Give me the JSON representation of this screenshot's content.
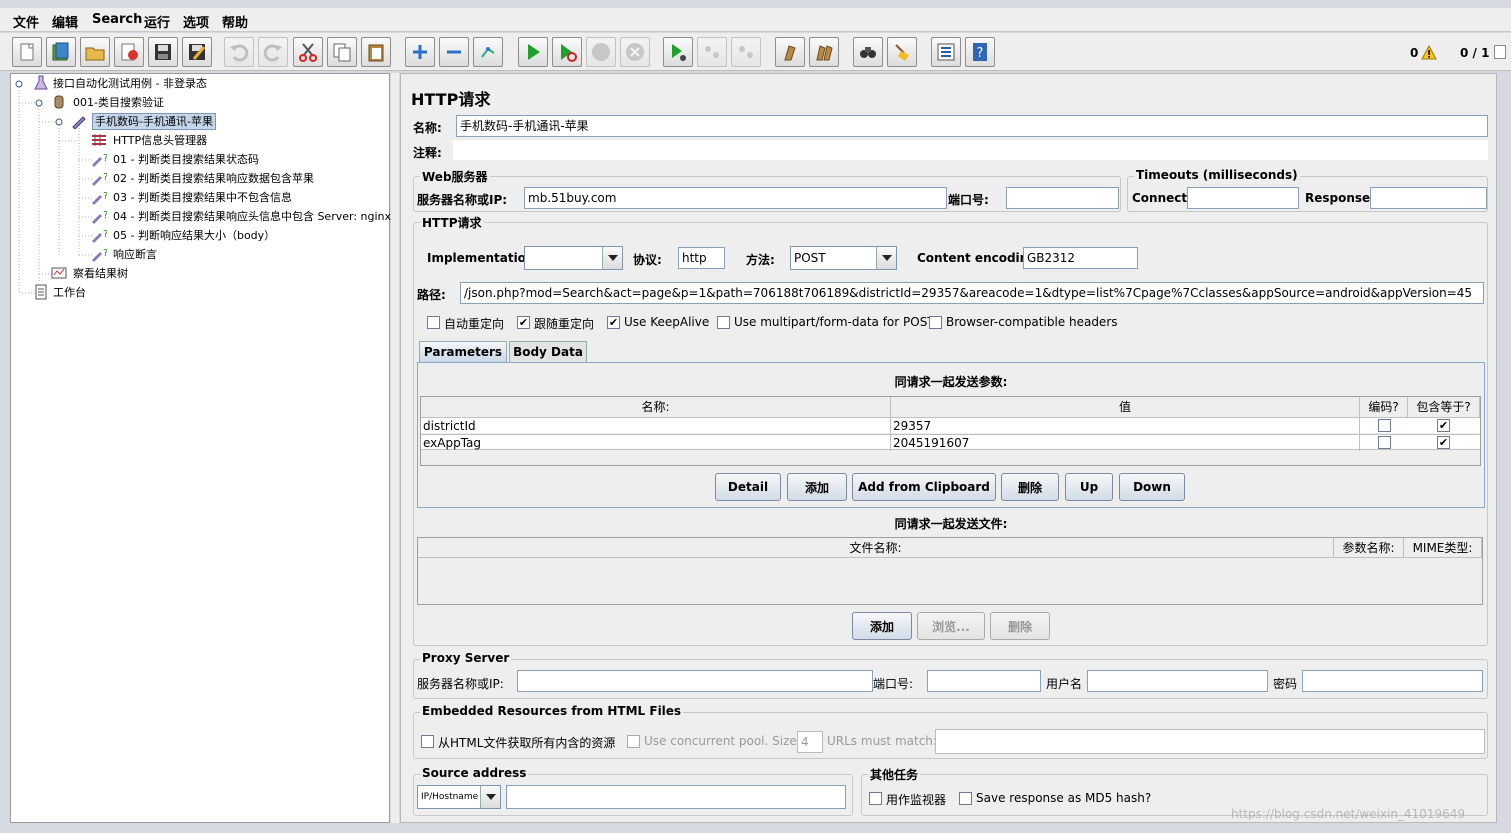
{
  "menubar": {
    "items": [
      "文件",
      "编辑",
      "Search",
      "运行",
      "选项",
      "帮助"
    ]
  },
  "toolbar": {
    "icons": [
      "new-icon",
      "templates-icon",
      "open-icon",
      "close-icon",
      "save-icon",
      "save-as-icon",
      "undo-icon",
      "redo-icon",
      "cut-icon",
      "copy-icon",
      "paste-icon",
      "expand-icon",
      "collapse-icon",
      "toggle-icon",
      "start-icon",
      "start-no-pause-icon",
      "stop-icon",
      "shutdown-icon",
      "remote-start-icon",
      "remote-stop-icon",
      "remote-exit-icon",
      "clear-icon",
      "clear-all-icon",
      "search-icon",
      "reset-search-icon",
      "function-helper-icon",
      "help-icon"
    ],
    "warnings": "0",
    "threads": "0 / 1"
  },
  "tree": {
    "items": [
      {
        "label": "接口自动化测试用例 - 非登录态",
        "icon": "test-plan-icon",
        "selected": false
      },
      {
        "label": "001-类目搜索验证",
        "icon": "thread-group-icon",
        "selected": false
      },
      {
        "label": "手机数码-手机通讯-苹果",
        "icon": "sampler-icon",
        "selected": true
      },
      {
        "label": "HTTP信息头管理器",
        "icon": "header-manager-icon",
        "selected": false
      },
      {
        "label": "01 - 判断类目搜索结果状态码",
        "icon": "assertion-icon",
        "selected": false
      },
      {
        "label": "02 - 判断类目搜索结果响应数据包含苹果",
        "icon": "assertion-icon",
        "selected": false
      },
      {
        "label": "03 - 判断类目搜索结果中不包含信息",
        "icon": "assertion-icon",
        "selected": false
      },
      {
        "label": "04 - 判断类目搜索结果响应头信息中包含 Server: nginx",
        "icon": "assertion-icon",
        "selected": false
      },
      {
        "label": "05 - 判断响应结果大小（body）",
        "icon": "assertion-icon",
        "selected": false
      },
      {
        "label": "响应断言",
        "icon": "assertion-icon",
        "selected": false
      },
      {
        "label": "察看结果树",
        "icon": "listener-icon",
        "selected": false
      },
      {
        "label": "工作台",
        "icon": "workbench-icon",
        "selected": false
      }
    ]
  },
  "panel": {
    "title": "HTTP请求",
    "name_label": "名称:",
    "name_value": "手机数码-手机通讯-苹果",
    "comment_label": "注释:",
    "web_server": {
      "title": "Web服务器",
      "server_label": "服务器名称或IP:",
      "server_value": "mb.51buy.com",
      "port_label": "端口号:",
      "port_value": ""
    },
    "timeouts": {
      "title": "Timeouts (milliseconds)",
      "connect_label": "Connect:",
      "response_label": "Response:"
    },
    "http_request": {
      "title": "HTTP请求",
      "impl_label": "Implementation:",
      "impl_value": "",
      "protocol_label": "协议:",
      "protocol_value": "http",
      "method_label": "方法:",
      "method_value": "POST",
      "encoding_label": "Content encoding:",
      "encoding_value": "GB2312",
      "path_label": "路径:",
      "path_value": "/json.php?mod=Search&act=page&p=1&path=706188t706189&districtId=29357&areacode=1&dtype=list%7Cpage%7Cclasses&appSource=android&appVersion=45",
      "checkboxes": [
        {
          "label": "自动重定向",
          "checked": false
        },
        {
          "label": "跟随重定向",
          "checked": true
        },
        {
          "label": "Use KeepAlive",
          "checked": true
        },
        {
          "label": "Use multipart/form-data for POST",
          "checked": false
        },
        {
          "label": "Browser-compatible headers",
          "checked": false
        }
      ]
    },
    "tabs": [
      "Parameters",
      "Body Data"
    ],
    "params": {
      "caption": "同请求一起发送参数:",
      "columns": [
        "名称:",
        "值",
        "编码?",
        "包含等于?"
      ],
      "rows": [
        {
          "name": "districtId",
          "value": "29357",
          "encode": false,
          "include_equals": true
        },
        {
          "name": "exAppTag",
          "value": "2045191607",
          "encode": false,
          "include_equals": true
        }
      ],
      "buttons": [
        "Detail",
        "添加",
        "Add from Clipboard",
        "删除",
        "Up",
        "Down"
      ]
    },
    "files": {
      "caption": "同请求一起发送文件:",
      "columns": [
        "文件名称:",
        "参数名称:",
        "MIME类型:"
      ],
      "buttons": [
        "添加",
        "浏览...",
        "删除"
      ]
    },
    "proxy": {
      "title": "Proxy Server",
      "server_label": "服务器名称或IP:",
      "port_label": "端口号:",
      "user_label": "用户名",
      "password_label": "密码"
    },
    "embedded": {
      "title": "Embedded Resources from HTML Files",
      "retrieve_label": "从HTML文件获取所有内含的资源",
      "pool_label": "Use concurrent pool. Size:",
      "pool_value": "4",
      "match_label": "URLs must match:"
    },
    "source": {
      "title": "Source address",
      "type_value": "IP/Hostname"
    },
    "other": {
      "title": "其他任务",
      "monitor_label": "用作监视器",
      "md5_label": "Save response as MD5 hash?"
    }
  },
  "watermark": "https://blog.csdn.net/weixin_41019649"
}
